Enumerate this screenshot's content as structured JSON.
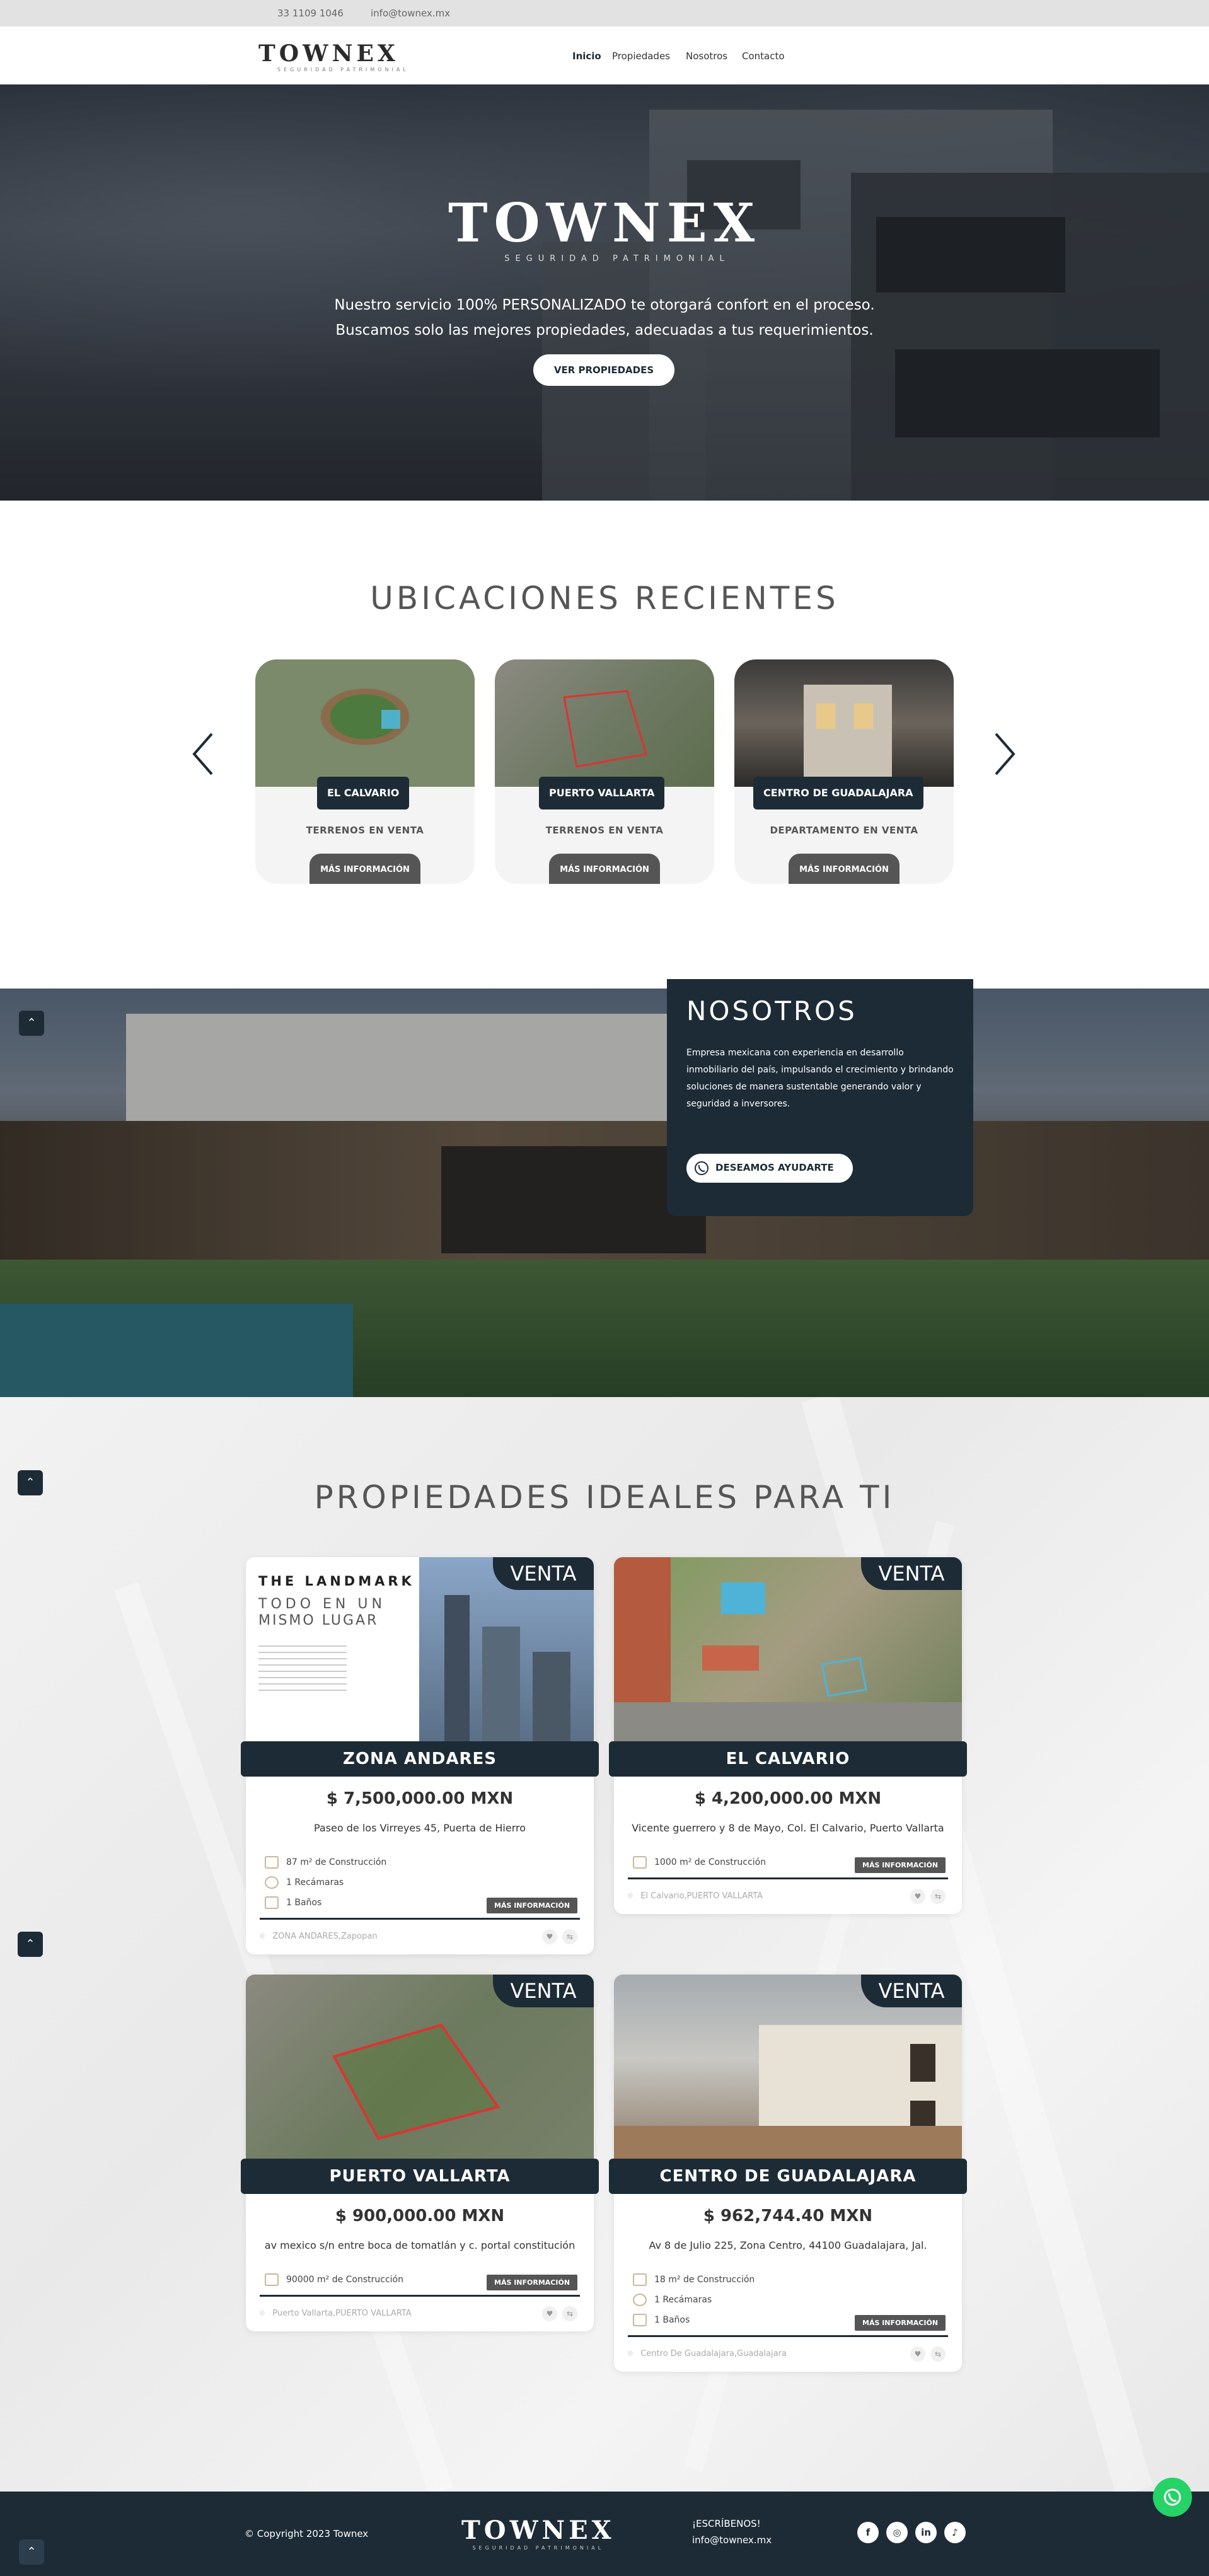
{
  "topbar": {
    "phone": "33 1109 1046",
    "email": "info@townex.mx"
  },
  "brand": {
    "name": "TOWNEX",
    "tagline": "SEGURIDAD PATRIMONIAL"
  },
  "nav": {
    "items": [
      "Inicio",
      "Propiedades",
      "Nosotros",
      "Contacto"
    ]
  },
  "hero": {
    "line1": "Nuestro servicio 100% PERSONALIZADO te otorgará confort en el proceso.",
    "line2": "Buscamos solo las mejores propiedades, adecuadas a tus requerimientos.",
    "cta": "VER PROPIEDADES"
  },
  "ubicaciones": {
    "title": "UBICACIONES RECIENTES",
    "cards": [
      {
        "name": "EL CALVARIO",
        "type": "TERRENOS EN VENTA",
        "button": "MÁS INFORMACIÓN"
      },
      {
        "name": "PUERTO VALLARTA",
        "type": "TERRENOS EN VENTA",
        "button": "MÁS INFORMACIÓN"
      },
      {
        "name": "CENTRO DE GUADALAJARA",
        "type": "DEPARTAMENTO EN VENTA",
        "button": "MÁS INFORMACIÓN"
      }
    ]
  },
  "nosotros": {
    "title": "NOSOTROS",
    "text": "Empresa mexicana con experiencia en desarrollo inmobiliario del país, impulsando el crecimiento y brindando soluciones de manera sustentable generando valor y seguridad a inversores.",
    "button": "DESEAMOS AYUDARTE"
  },
  "propiedades": {
    "title": "PROPIEDADES IDEALES PARA TI",
    "badge": "VENTA",
    "unit": "m² de Construcción",
    "more": "MÁS INFORMACIÓN",
    "cards": [
      {
        "title": "ZONA ANDARES",
        "price": "$ 7,500,000.00 MXN",
        "address": "Paseo de los Virreyes 45, Puerta de Hierro",
        "area": "87",
        "rooms": "1 Recámaras",
        "baths": "1 Baños",
        "location": "ZONA ANDARES,Zapopan",
        "img_text": {
          "headline": "THE LANDMARK",
          "sub1": "TODO EN UN",
          "sub2": "MISMO LUGAR"
        }
      },
      {
        "title": "EL CALVARIO",
        "price": "$ 4,200,000.00 MXN",
        "address": "Vicente guerrero y 8 de Mayo, Col. El Calvario, Puerto Vallarta",
        "area": "1000",
        "location": "El Calvario,PUERTO VALLARTA"
      },
      {
        "title": "PUERTO VALLARTA",
        "price": "$ 900,000.00 MXN",
        "address": "av mexico s/n entre boca de tomatlán y c. portal constitución",
        "area": "90000",
        "location": "Puerto Vallarta,PUERTO VALLARTA"
      },
      {
        "title": "CENTRO DE GUADALAJARA",
        "price": "$ 962,744.40 MXN",
        "address": "Av 8 de Julio 225, Zona Centro, 44100 Guadalajara, Jal.",
        "area": "18",
        "rooms": "1 Recámaras",
        "baths": "1 Baños",
        "location": "Centro De Guadalajara,Guadalajara"
      }
    ]
  },
  "footer": {
    "copyright": "© Copyright 2023 Townex",
    "contact_label": "¡ESCRÍBENOS!",
    "email": "info@townex.mx"
  },
  "icons": [
    "chevron-left-icon",
    "chevron-right-icon",
    "whatsapp-icon",
    "facebook-icon",
    "instagram-icon",
    "linkedin-icon",
    "tiktok-icon",
    "chevron-up-icon",
    "heart-icon",
    "compare-icon",
    "map-pin-icon",
    "area-icon",
    "bed-icon",
    "bath-icon"
  ],
  "colors": {
    "primary": "#1d2b36",
    "button_gray": "#555555",
    "whatsapp": "#25d366"
  }
}
